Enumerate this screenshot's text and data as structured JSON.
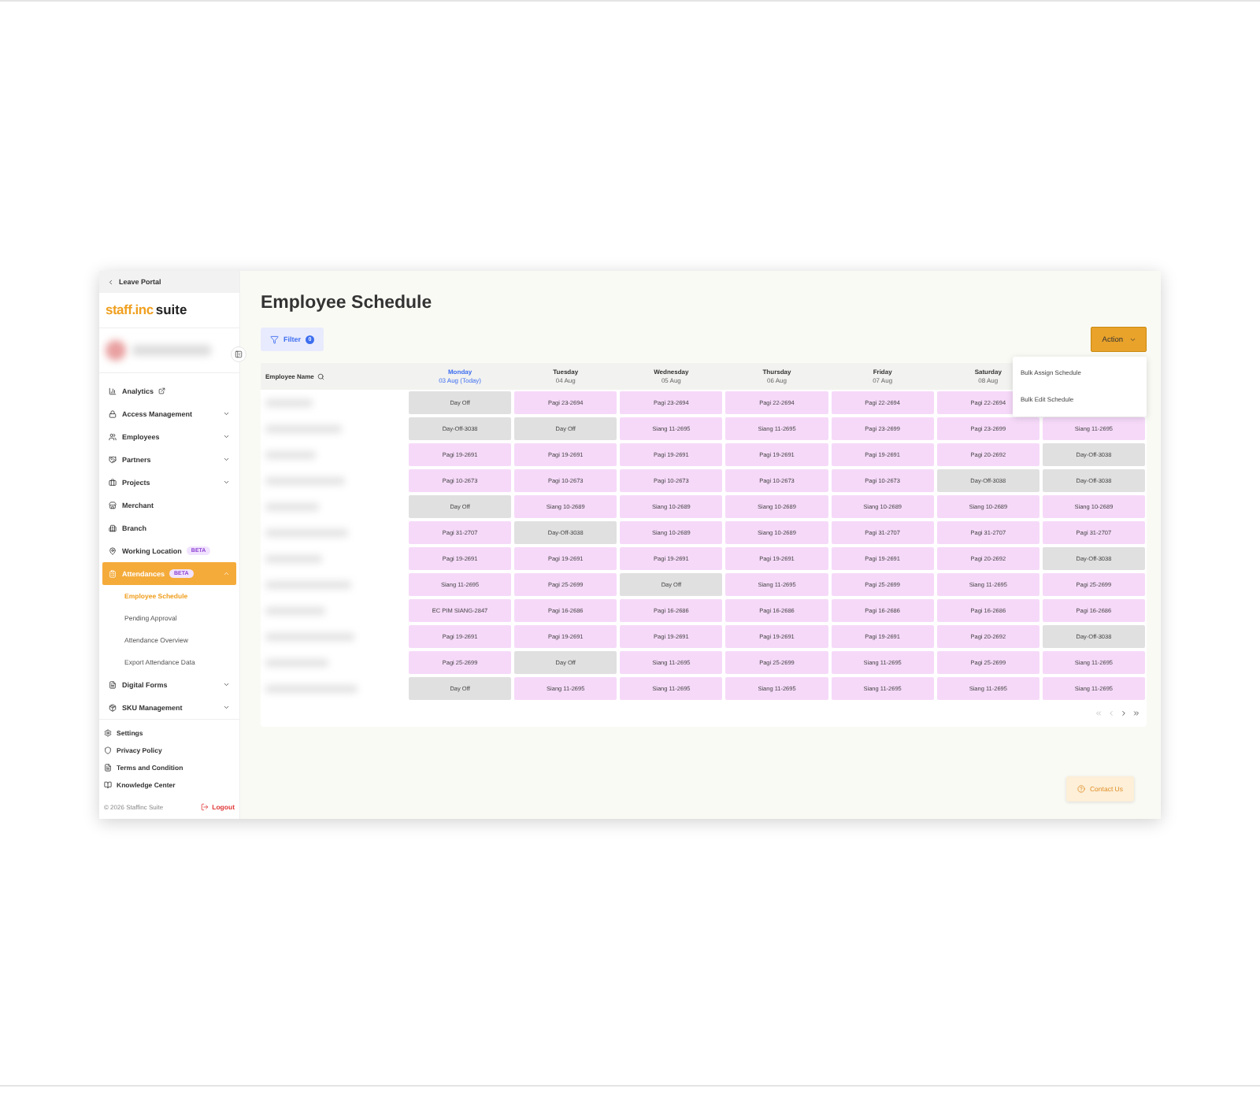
{
  "sidebar": {
    "back_link": "Leave Portal",
    "logo": {
      "brand": "staff.inc",
      "suffix": "suite"
    },
    "items": [
      {
        "label": "Analytics",
        "external": true,
        "has_children": false,
        "selected": false
      },
      {
        "label": "Access Management",
        "has_children": true,
        "expanded": false,
        "selected": false
      },
      {
        "label": "Employees",
        "has_children": true,
        "expanded": false,
        "selected": false
      },
      {
        "label": "Partners",
        "has_children": true,
        "expanded": false,
        "selected": false
      },
      {
        "label": "Projects",
        "has_children": true,
        "expanded": false,
        "selected": false
      },
      {
        "label": "Merchant",
        "has_children": false,
        "selected": false
      },
      {
        "label": "Branch",
        "has_children": false,
        "selected": false
      },
      {
        "label": "Working Location",
        "badge": "BETA",
        "has_children": false,
        "selected": false
      },
      {
        "label": "Attendances",
        "badge": "BETA",
        "has_children": true,
        "expanded": true,
        "selected": true,
        "children": [
          {
            "label": "Employee Schedule",
            "selected": true
          },
          {
            "label": "Pending Approval",
            "selected": false
          },
          {
            "label": "Attendance Overview",
            "selected": false
          },
          {
            "label": "Export Attendance Data",
            "selected": false
          }
        ]
      },
      {
        "label": "Digital Forms",
        "has_children": true,
        "expanded": false,
        "selected": false
      },
      {
        "label": "SKU Management",
        "has_children": true,
        "expanded": false,
        "selected": false
      }
    ],
    "footer_links": [
      "Settings",
      "Privacy Policy",
      "Terms and Condition",
      "Knowledge Center"
    ],
    "copyright": "© 2026 Staffinc Suite",
    "logout": "Logout"
  },
  "page": {
    "title": "Employee Schedule",
    "filter": {
      "label": "Filter",
      "count": "0"
    },
    "action": {
      "label": "Action",
      "expanded": true,
      "menu": [
        "Bulk Assign Schedule",
        "Bulk Edit Schedule"
      ]
    }
  },
  "table": {
    "name_column": "Employee Name",
    "days": [
      {
        "day": "Monday",
        "date": "03 Aug (Today)",
        "today": true
      },
      {
        "day": "Tuesday",
        "date": "04 Aug",
        "today": false
      },
      {
        "day": "Wednesday",
        "date": "05 Aug",
        "today": false
      },
      {
        "day": "Thursday",
        "date": "06 Aug",
        "today": false
      },
      {
        "day": "Friday",
        "date": "07 Aug",
        "today": false
      },
      {
        "day": "Saturday",
        "date": "08 Aug",
        "today": false
      }
    ],
    "rows": [
      [
        {
          "text": "Day Off",
          "kind": "off"
        },
        {
          "text": "Pagi 23-2694",
          "kind": "shift"
        },
        {
          "text": "Pagi 23-2694",
          "kind": "shift"
        },
        {
          "text": "Pagi 22-2694",
          "kind": "shift"
        },
        {
          "text": "Pagi 22-2694",
          "kind": "shift"
        },
        {
          "text": "Pagi 22-2694",
          "kind": "shift"
        }
      ],
      [
        {
          "text": "Day-Off-3038",
          "kind": "off"
        },
        {
          "text": "Day Off",
          "kind": "off"
        },
        {
          "text": "Siang 11-2695",
          "kind": "shift"
        },
        {
          "text": "Siang 11-2695",
          "kind": "shift"
        },
        {
          "text": "Pagi 23-2699",
          "kind": "shift"
        },
        {
          "text": "Pagi 23-2699",
          "kind": "shift"
        },
        {
          "text": "Siang 11-2695",
          "kind": "shift"
        }
      ],
      [
        {
          "text": "Pagi 19-2691",
          "kind": "shift"
        },
        {
          "text": "Pagi 19-2691",
          "kind": "shift"
        },
        {
          "text": "Pagi 19-2691",
          "kind": "shift"
        },
        {
          "text": "Pagi 19-2691",
          "kind": "shift"
        },
        {
          "text": "Pagi 19-2691",
          "kind": "shift"
        },
        {
          "text": "Pagi 20-2692",
          "kind": "shift"
        },
        {
          "text": "Day-Off-3038",
          "kind": "off"
        }
      ],
      [
        {
          "text": "Pagi 10-2673",
          "kind": "shift"
        },
        {
          "text": "Pagi 10-2673",
          "kind": "shift"
        },
        {
          "text": "Pagi 10-2673",
          "kind": "shift"
        },
        {
          "text": "Pagi 10-2673",
          "kind": "shift"
        },
        {
          "text": "Pagi 10-2673",
          "kind": "shift"
        },
        {
          "text": "Day-Off-3038",
          "kind": "off"
        },
        {
          "text": "Day-Off-3038",
          "kind": "off"
        }
      ],
      [
        {
          "text": "Day Off",
          "kind": "off"
        },
        {
          "text": "Siang 10-2689",
          "kind": "shift"
        },
        {
          "text": "Siang 10-2689",
          "kind": "shift"
        },
        {
          "text": "Siang 10-2689",
          "kind": "shift"
        },
        {
          "text": "Siang 10-2689",
          "kind": "shift"
        },
        {
          "text": "Siang 10-2689",
          "kind": "shift"
        },
        {
          "text": "Siang 10-2689",
          "kind": "shift"
        }
      ],
      [
        {
          "text": "Pagi 31-2707",
          "kind": "shift"
        },
        {
          "text": "Day-Off-3038",
          "kind": "off"
        },
        {
          "text": "Siang 10-2689",
          "kind": "shift"
        },
        {
          "text": "Siang 10-2689",
          "kind": "shift"
        },
        {
          "text": "Pagi 31-2707",
          "kind": "shift"
        },
        {
          "text": "Pagi 31-2707",
          "kind": "shift"
        },
        {
          "text": "Pagi 31-2707",
          "kind": "shift"
        }
      ],
      [
        {
          "text": "Pagi 19-2691",
          "kind": "shift"
        },
        {
          "text": "Pagi 19-2691",
          "kind": "shift"
        },
        {
          "text": "Pagi 19-2691",
          "kind": "shift"
        },
        {
          "text": "Pagi 19-2691",
          "kind": "shift"
        },
        {
          "text": "Pagi 19-2691",
          "kind": "shift"
        },
        {
          "text": "Pagi 20-2692",
          "kind": "shift"
        },
        {
          "text": "Day-Off-3038",
          "kind": "off"
        }
      ],
      [
        {
          "text": "Siang 11-2695",
          "kind": "shift"
        },
        {
          "text": "Pagi 25-2699",
          "kind": "shift"
        },
        {
          "text": "Day Off",
          "kind": "off"
        },
        {
          "text": "Siang 11-2695",
          "kind": "shift"
        },
        {
          "text": "Pagi 25-2699",
          "kind": "shift"
        },
        {
          "text": "Siang 11-2695",
          "kind": "shift"
        },
        {
          "text": "Pagi 25-2699",
          "kind": "shift"
        }
      ],
      [
        {
          "text": "EC PIM SIANG-2847",
          "kind": "shift"
        },
        {
          "text": "Pagi 16-2686",
          "kind": "shift"
        },
        {
          "text": "Pagi 16-2686",
          "kind": "shift"
        },
        {
          "text": "Pagi 16-2686",
          "kind": "shift"
        },
        {
          "text": "Pagi 16-2686",
          "kind": "shift"
        },
        {
          "text": "Pagi 16-2686",
          "kind": "shift"
        },
        {
          "text": "Pagi 16-2686",
          "kind": "shift"
        }
      ],
      [
        {
          "text": "Pagi 19-2691",
          "kind": "shift"
        },
        {
          "text": "Pagi 19-2691",
          "kind": "shift"
        },
        {
          "text": "Pagi 19-2691",
          "kind": "shift"
        },
        {
          "text": "Pagi 19-2691",
          "kind": "shift"
        },
        {
          "text": "Pagi 19-2691",
          "kind": "shift"
        },
        {
          "text": "Pagi 20-2692",
          "kind": "shift"
        },
        {
          "text": "Day-Off-3038",
          "kind": "off"
        }
      ],
      [
        {
          "text": "Pagi 25-2699",
          "kind": "shift"
        },
        {
          "text": "Day Off",
          "kind": "off"
        },
        {
          "text": "Siang 11-2695",
          "kind": "shift"
        },
        {
          "text": "Pagi 25-2699",
          "kind": "shift"
        },
        {
          "text": "Siang 11-2695",
          "kind": "shift"
        },
        {
          "text": "Pagi 25-2699",
          "kind": "shift"
        },
        {
          "text": "Siang 11-2695",
          "kind": "shift"
        }
      ],
      [
        {
          "text": "Day Off",
          "kind": "off"
        },
        {
          "text": "Siang 11-2695",
          "kind": "shift"
        },
        {
          "text": "Siang 11-2695",
          "kind": "shift"
        },
        {
          "text": "Siang 11-2695",
          "kind": "shift"
        },
        {
          "text": "Siang 11-2695",
          "kind": "shift"
        },
        {
          "text": "Siang 11-2695",
          "kind": "shift"
        },
        {
          "text": "Siang 11-2695",
          "kind": "shift"
        }
      ]
    ]
  },
  "contact": "Contact Us"
}
